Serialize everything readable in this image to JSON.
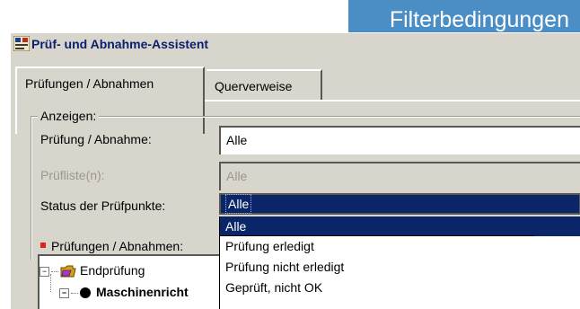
{
  "banner": {
    "text": "Filterbedingungen",
    "color": "#4a8ec5"
  },
  "window": {
    "title": "Prüf- und Abnahme-Assistent",
    "icon": "assistant-app-icon"
  },
  "tabs": [
    {
      "label": "Prüfungen / Abnahmen",
      "active": true
    },
    {
      "label": "Querverweise",
      "active": false
    }
  ],
  "group": {
    "legend": "Anzeigen:",
    "fields": {
      "pruefung": {
        "label": "Prüfung / Abnahme:",
        "value": "Alle"
      },
      "liste": {
        "label": "Prüfliste(n):",
        "value": "Alle",
        "disabled": true
      },
      "status": {
        "label": "Status der Prüfpunkte:",
        "value": "Alle"
      }
    }
  },
  "status_dropdown": {
    "options": [
      "Alle",
      "Prüfung erledigt",
      "Prüfung nicht erledigt",
      "Geprüft, nicht OK"
    ],
    "selected": "Alle"
  },
  "tree_section": {
    "label": "Prüfungen / Abnahmen:",
    "bullet_color": "#e0211c",
    "items": [
      {
        "label": "Endprüfung",
        "icon": "folder-icon",
        "expanded": true
      },
      {
        "label": "Maschinenricht",
        "icon": "dot-icon",
        "expanded": true
      }
    ]
  },
  "colors": {
    "selection": "#0b2569",
    "window_bg": "#d8d5cc"
  }
}
